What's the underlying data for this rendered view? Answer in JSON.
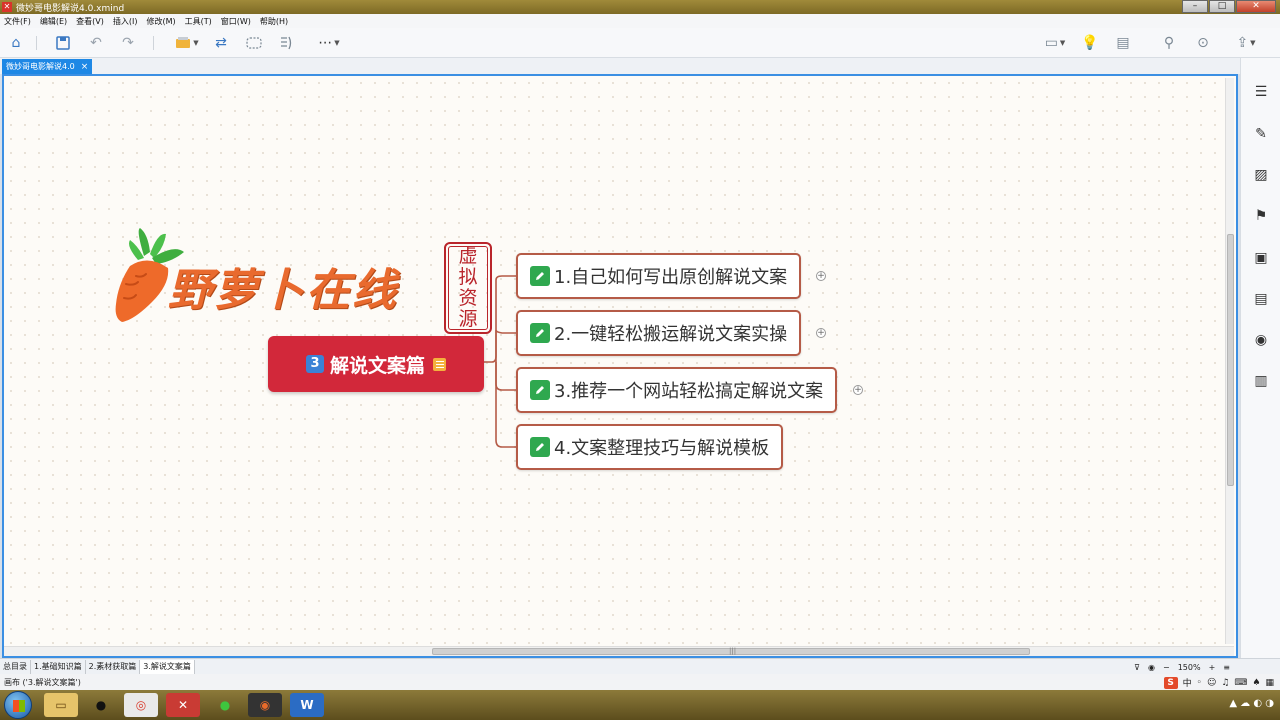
{
  "window": {
    "title": "微妙哥电影解说4.0.xmind",
    "app_icon": "xmind-icon"
  },
  "menu": [
    "文件(F)",
    "编辑(E)",
    "查看(V)",
    "插入(I)",
    "修改(M)",
    "工具(T)",
    "窗口(W)",
    "帮助(H)"
  ],
  "toolbar": {
    "icons": [
      "home-icon",
      "save-icon",
      "undo-icon",
      "redo-icon",
      "topic-style-icon",
      "relationship-icon",
      "boundary-icon",
      "summary-icon",
      "more-icon",
      "presentation-icon",
      "idea-icon",
      "export-icon",
      "search-icon",
      "settings-icon",
      "share-icon"
    ]
  },
  "doc_tab": {
    "label": "微妙哥电影解说4.0",
    "close": "×"
  },
  "logo": {
    "text": "野萝卜在线",
    "seal_chars": [
      "虚",
      "拟",
      "资",
      "源"
    ]
  },
  "central": {
    "badge": "3",
    "label": "解说文案篇"
  },
  "topics": [
    {
      "label": "1.自己如何写出原创解说文案",
      "expand": "+"
    },
    {
      "label": "2.一键轻松搬运解说文案实操",
      "expand": "+"
    },
    {
      "label": "3.推荐一个网站轻松搞定解说文案",
      "expand": "+"
    },
    {
      "label": "4.文案整理技巧与解说模板"
    }
  ],
  "colors": {
    "central": "#d2283a",
    "topic_border": "#b55b47",
    "accent": "#3b8fe3",
    "logo": "#e96a2e"
  },
  "sheets": [
    "总目录",
    "1.基础知识篇",
    "2.素材获取篇",
    "3.解说文案篇"
  ],
  "active_sheet": 3,
  "zoom": {
    "value": "150%",
    "minus": "−",
    "plus": "+"
  },
  "status": {
    "text": "画布 ('3.解说文案篇')"
  },
  "ime": {
    "logo": "S",
    "lang": "中"
  }
}
